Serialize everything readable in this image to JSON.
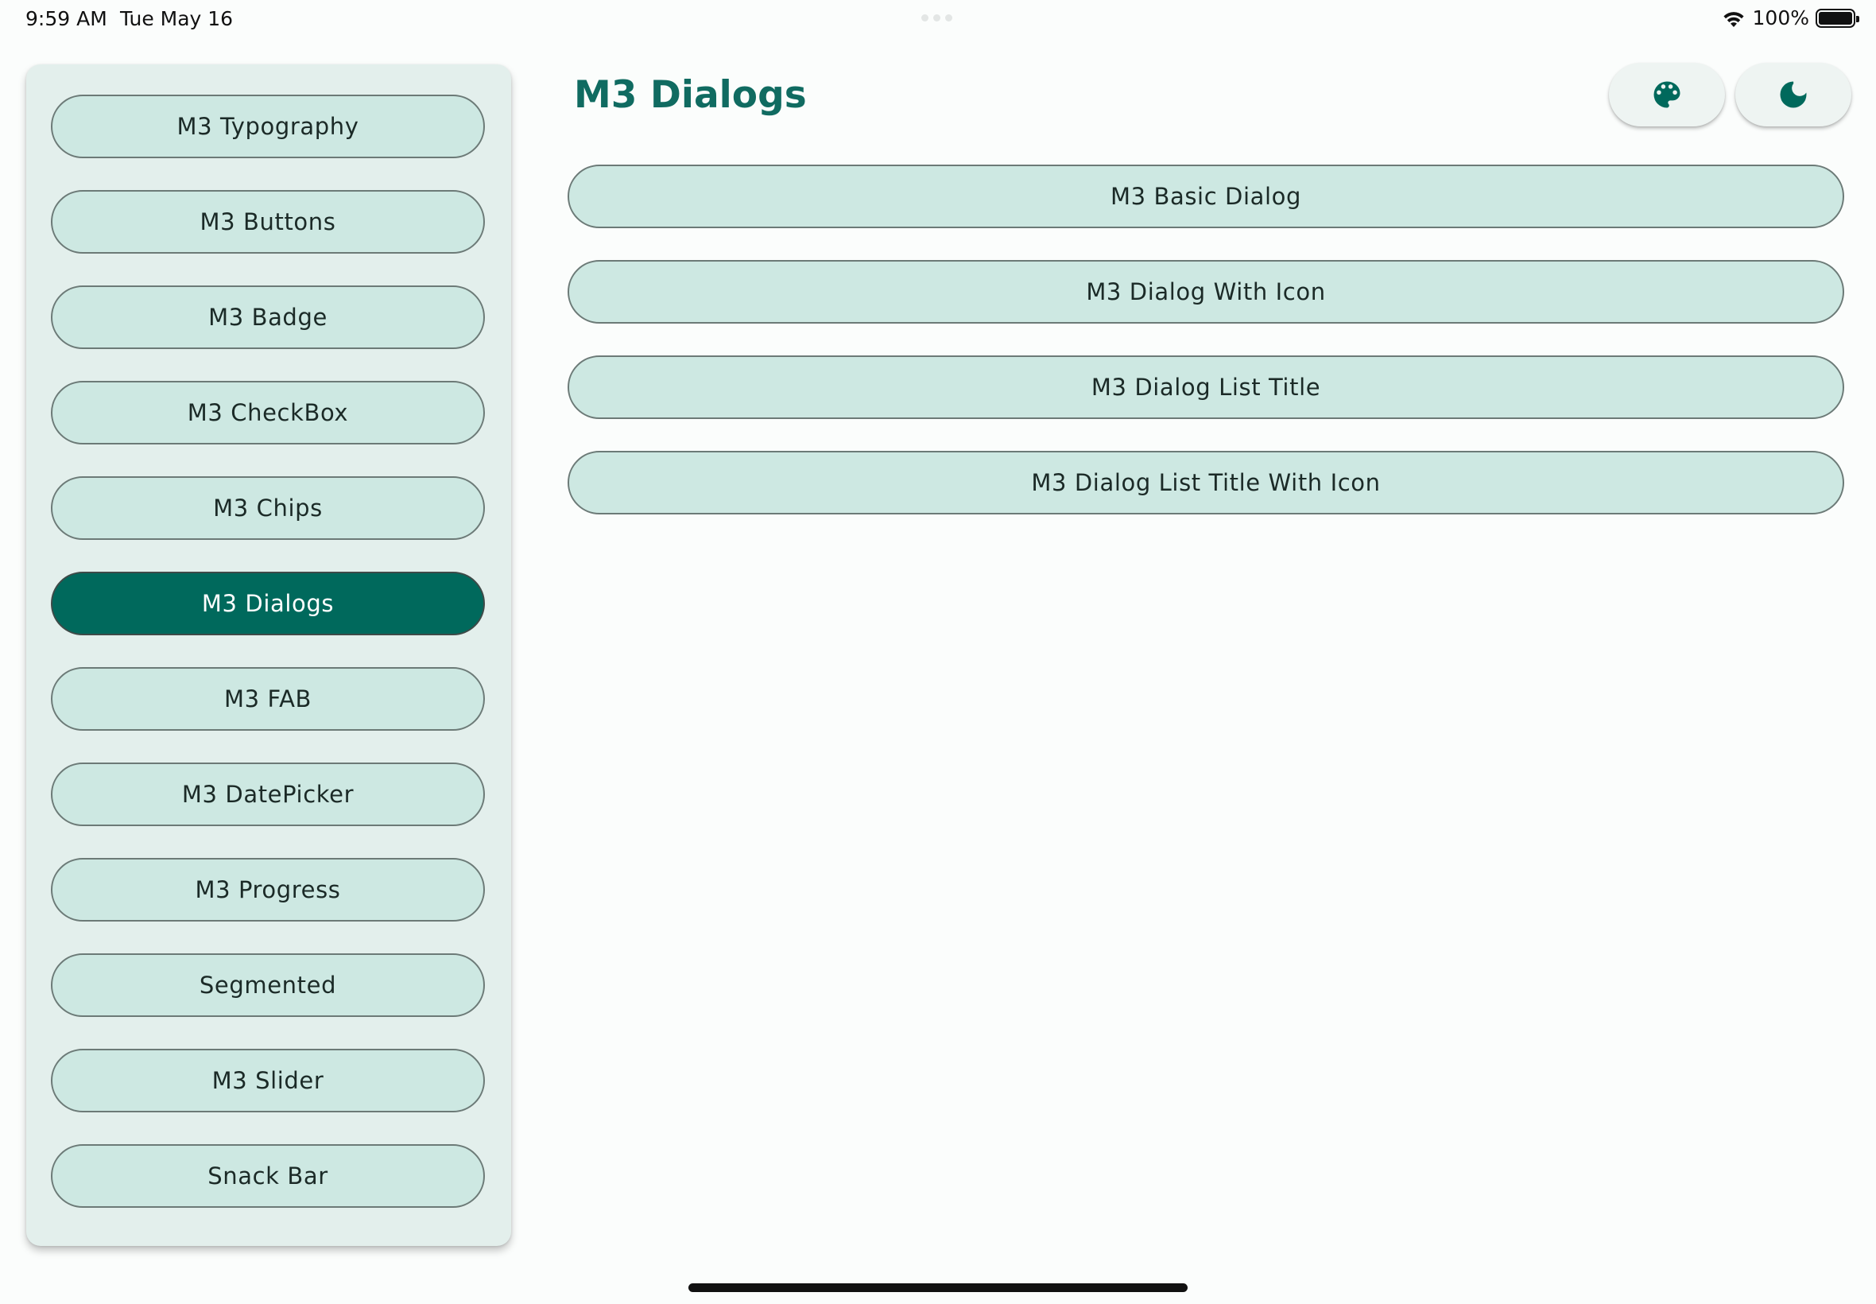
{
  "status_bar": {
    "time": "9:59 AM",
    "date": "Tue May 16",
    "battery": "100%",
    "battery_level": 1.0
  },
  "sidebar": {
    "items": [
      {
        "label": "M3 Typography"
      },
      {
        "label": "M3 Buttons"
      },
      {
        "label": "M3 Badge"
      },
      {
        "label": "M3 CheckBox"
      },
      {
        "label": "M3 Chips"
      },
      {
        "label": "M3 Dialogs"
      },
      {
        "label": "M3 FAB"
      },
      {
        "label": "M3 DatePicker"
      },
      {
        "label": "M3 Progress"
      },
      {
        "label": "Segmented"
      },
      {
        "label": "M3 Slider"
      },
      {
        "label": "Snack Bar"
      }
    ],
    "selected": "M3 Dialogs"
  },
  "header": {
    "title": "M3 Dialogs",
    "actions": [
      {
        "icon": "palette-icon"
      },
      {
        "icon": "dark-mode-icon"
      }
    ]
  },
  "main": {
    "buttons": [
      {
        "label": "M3 Basic Dialog"
      },
      {
        "label": "M3 Dialog With Icon"
      },
      {
        "label": "M3 Dialog List Title"
      },
      {
        "label": "M3 Dialog List Title With Icon"
      }
    ]
  },
  "colors": {
    "primary": "#00695c",
    "title": "#106b61",
    "button_fill": "#cde8e2",
    "sidebar_bg": "#e3efec",
    "background": "#fbfdfc"
  }
}
